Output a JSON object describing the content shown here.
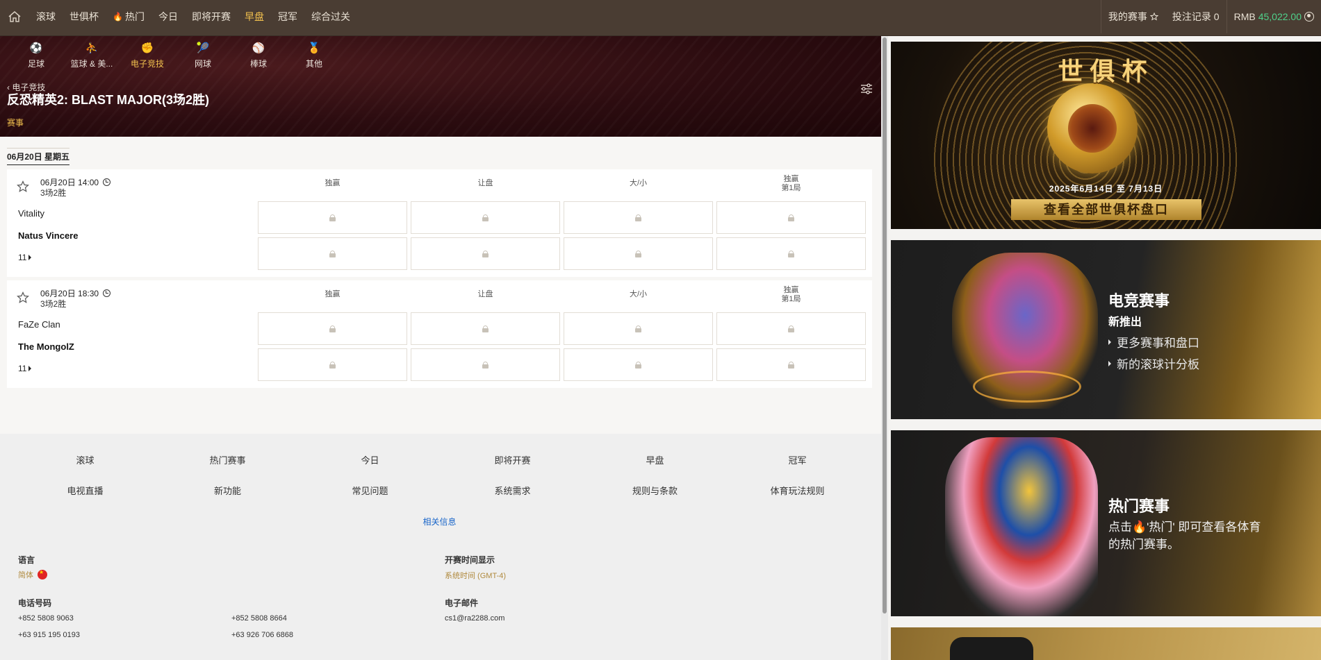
{
  "nav": {
    "items": [
      {
        "label": "滚球",
        "active": false
      },
      {
        "label": "世俱杯",
        "active": false
      },
      {
        "label": "热门",
        "active": false,
        "icon": "fire-icon"
      },
      {
        "label": "今日",
        "active": false
      },
      {
        "label": "即将开赛",
        "active": false
      },
      {
        "label": "早盘",
        "active": true
      },
      {
        "label": "冠军",
        "active": false
      },
      {
        "label": "综合过关",
        "active": false
      }
    ],
    "my_events": "我的赛事",
    "bet_record": "投注记录 0",
    "currency": "RMB",
    "balance": "45,022.00"
  },
  "sports": [
    {
      "label": "足球",
      "icon": "soccer-icon",
      "glyph": "⚽"
    },
    {
      "label": "篮球 & 美...",
      "icon": "basketball-football-icon",
      "glyph": "⛹"
    },
    {
      "label": "电子竞技",
      "icon": "esports-icon",
      "glyph": "✊",
      "active": true
    },
    {
      "label": "网球",
      "icon": "tennis-icon",
      "glyph": "🎾"
    },
    {
      "label": "棒球",
      "icon": "baseball-icon",
      "glyph": "⚾"
    },
    {
      "label": "其他",
      "icon": "medal-icon",
      "glyph": "🏅"
    }
  ],
  "breadcrumb": "电子竞技",
  "page_title": "反恐精英2: BLAST MAJOR(3场2胜)",
  "tab_label": "赛事",
  "date_header": "06月20日 星期五",
  "market_headers": [
    "独赢",
    "让盘",
    "大/小",
    "独赢\n第1局"
  ],
  "matches": [
    {
      "time": "06月20日 14:00",
      "format": "3场2胜",
      "team1": "Vitality",
      "team2": "Natus Vincere",
      "more_count": "11"
    },
    {
      "time": "06月20日 18:30",
      "format": "3场2胜",
      "team1": "FaZe Clan",
      "team2": "The MongolZ",
      "more_count": "11"
    }
  ],
  "footer": {
    "links": [
      "滚球",
      "热门赛事",
      "今日",
      "即将开赛",
      "早盘",
      "冠军",
      "电视直播",
      "新功能",
      "常见问题",
      "系统需求",
      "规则与条款",
      "体育玩法规则"
    ],
    "related": "相关信息",
    "language_label": "语言",
    "language_value": "简体",
    "time_label": "开赛时间显示",
    "time_value": "系统时间 (GMT-4)",
    "phone_label": "电话号码",
    "phones": [
      "+852 5808 9063",
      "+852 5808 8664",
      "+63 915 195 0193",
      "+63 926 706 6868"
    ],
    "email_label": "电子邮件",
    "email": "cs1@ra2288.com"
  },
  "promos": {
    "worldcup_title": "世俱杯",
    "worldcup_dates": "2025年6月14日 至 7月13日",
    "worldcup_button": "查看全部世俱杯盘口",
    "esports_title": "电竞赛事",
    "esports_sub": "新推出",
    "esports_bullets": [
      "更多赛事和盘口",
      "新的滚球计分板"
    ],
    "hot_title": "热门赛事",
    "hot_text": "点击🔥'热门' 即可查看各体育的热门赛事。"
  },
  "colors": {
    "accent": "#f2c14e",
    "balance": "#4fd18b",
    "topbar": "#4a3d33",
    "link": "#1a66c9"
  }
}
